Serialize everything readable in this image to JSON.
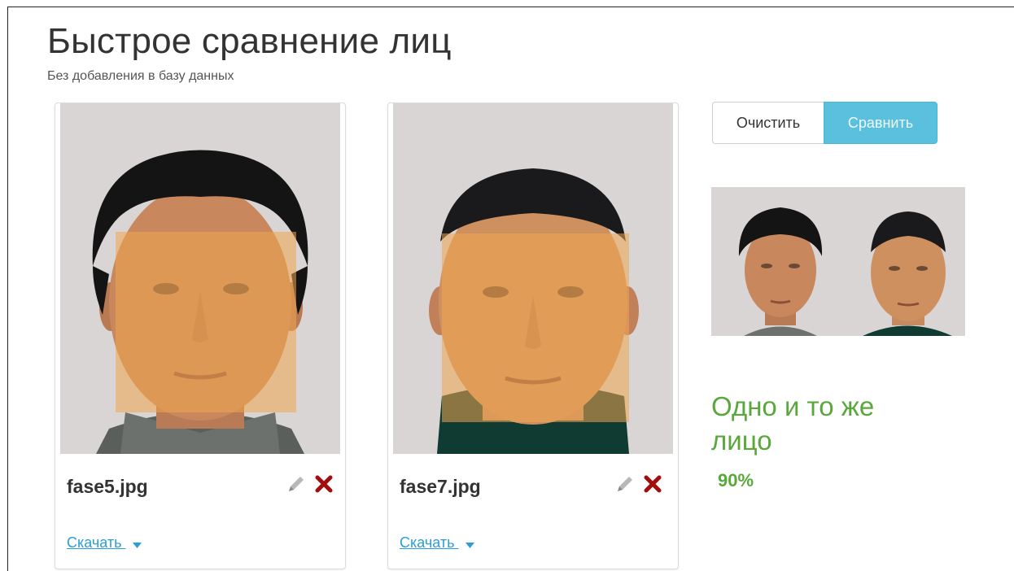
{
  "header": {
    "title": "Быстрое сравнение лиц",
    "subtitle": "Без добавления в базу данных"
  },
  "cards": [
    {
      "filename": "fase5.jpg",
      "download_label": "Скачать"
    },
    {
      "filename": "fase7.jpg",
      "download_label": "Скачать"
    }
  ],
  "actions": {
    "clear_label": "Очистить",
    "compare_label": "Сравнить"
  },
  "result": {
    "verdict": "Одно и то же лицо",
    "percent": "90%"
  },
  "colors": {
    "accent": "#5bc0de",
    "link": "#2a9fd6",
    "result": "#5aa83c",
    "delete": "#a30d0d"
  },
  "icons": [
    "pencil-icon",
    "delete-x-icon",
    "caret-down-icon"
  ]
}
